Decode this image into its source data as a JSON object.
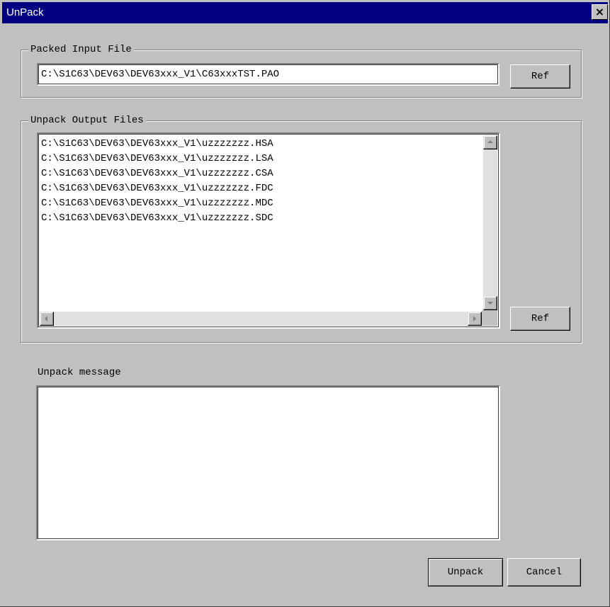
{
  "window": {
    "title": "UnPack",
    "close_icon": "close-icon"
  },
  "packed_input": {
    "legend": "Packed Input File",
    "value": "C:\\S1C63\\DEV63\\DEV63xxx_V1\\C63xxxTST.PAO",
    "ref_label": "Ref"
  },
  "unpack_output": {
    "legend": "Unpack Output Files",
    "files": [
      "C:\\S1C63\\DEV63\\DEV63xxx_V1\\uzzzzzzz.HSA",
      "C:\\S1C63\\DEV63\\DEV63xxx_V1\\uzzzzzzz.LSA",
      "C:\\S1C63\\DEV63\\DEV63xxx_V1\\uzzzzzzz.CSA",
      "C:\\S1C63\\DEV63\\DEV63xxx_V1\\uzzzzzzz.FDC",
      "C:\\S1C63\\DEV63\\DEV63xxx_V1\\uzzzzzzz.MDC",
      "C:\\S1C63\\DEV63\\DEV63xxx_V1\\uzzzzzzz.SDC"
    ],
    "ref_label": "Ref"
  },
  "message": {
    "label": "Unpack message",
    "value": ""
  },
  "actions": {
    "unpack_label": "Unpack",
    "cancel_label": "Cancel"
  }
}
